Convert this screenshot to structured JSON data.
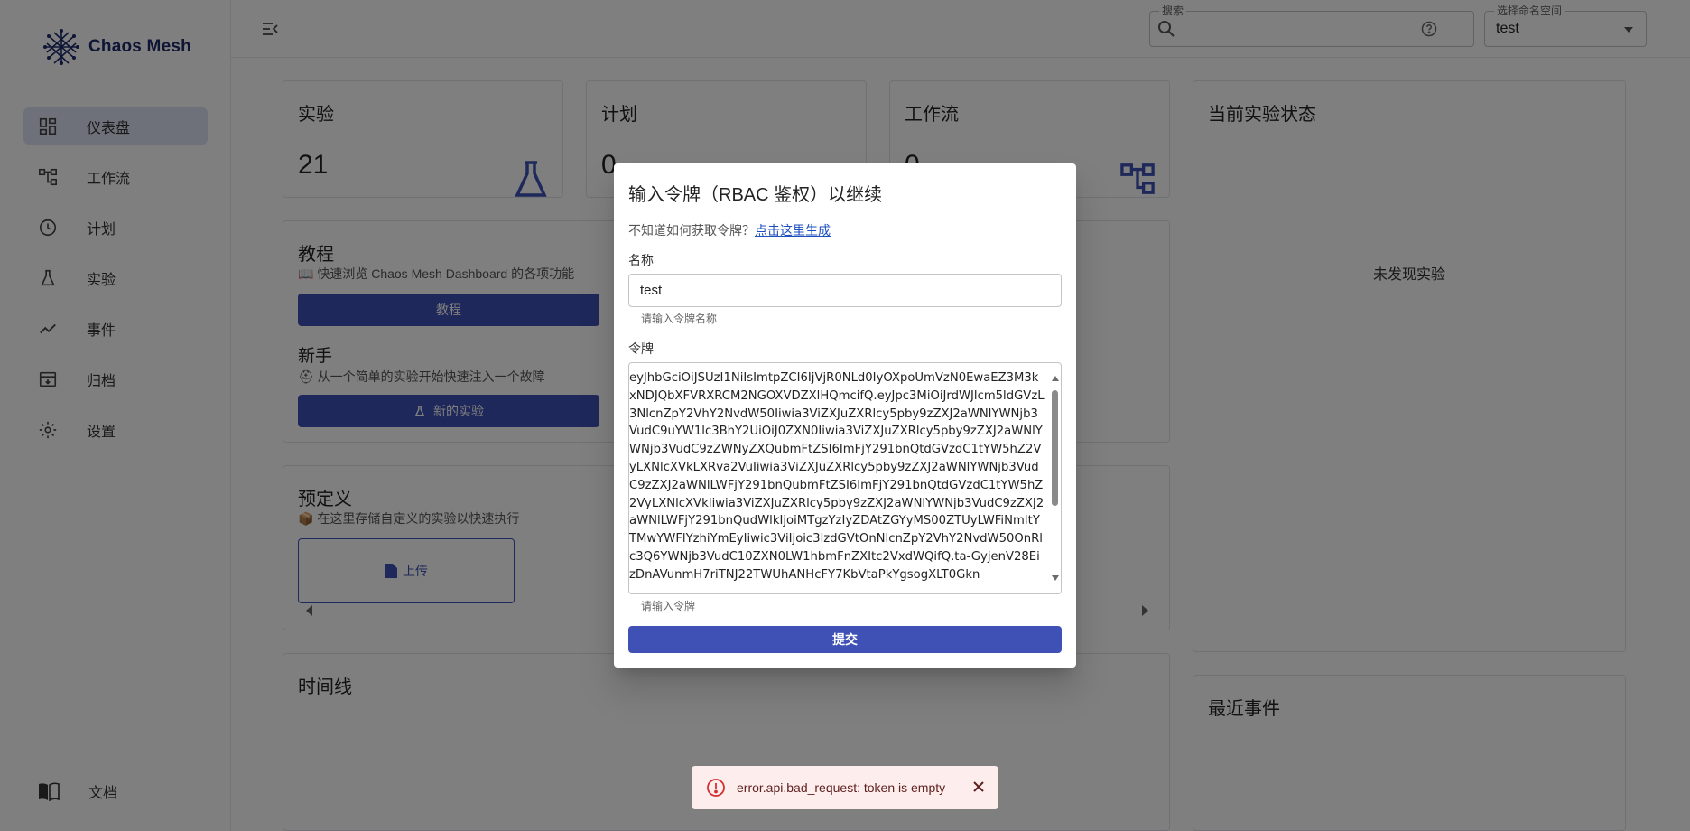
{
  "app": {
    "name": "Chaos Mesh"
  },
  "sidebar": {
    "items": [
      {
        "label": "仪表盘",
        "icon": "dashboard-icon",
        "active": true
      },
      {
        "label": "工作流",
        "icon": "workflow-icon"
      },
      {
        "label": "计划",
        "icon": "clock-icon"
      },
      {
        "label": "实验",
        "icon": "flask-icon"
      },
      {
        "label": "事件",
        "icon": "trending-icon"
      },
      {
        "label": "归档",
        "icon": "archive-icon"
      },
      {
        "label": "设置",
        "icon": "gear-icon"
      }
    ],
    "docs_label": "文档"
  },
  "topbar": {
    "search_label": "搜索",
    "search_value": "",
    "namespace_label": "选择命名空间",
    "namespace_value": "test"
  },
  "dashboard": {
    "stats": [
      {
        "title": "实验",
        "value": "21"
      },
      {
        "title": "计划",
        "value": "0"
      },
      {
        "title": "工作流",
        "value": "0"
      }
    ],
    "tutorial": {
      "title": "教程",
      "desc": "📖 快速浏览 Chaos Mesh Dashboard 的各项功能",
      "button": "教程",
      "newbie_title": "新手",
      "newbie_desc": "⛑ 从一个简单的实验开始快速注入一个故障",
      "new_experiment_button": "新的实验"
    },
    "predefined": {
      "title": "预定义",
      "desc": "📦 在这里存储自定义的实验以快速执行",
      "upload_label": "上传"
    },
    "timeline_title": "时间线",
    "current_status": {
      "title": "当前实验状态",
      "empty": "未发现实验"
    },
    "recent_events_title": "最近事件"
  },
  "dialog": {
    "title": "输入令牌（RBAC 鉴权）以继续",
    "hint_prefix": "不知道如何获取令牌？",
    "hint_link": "点击这里生成",
    "name_label": "名称",
    "name_value": "test",
    "name_helper": "请输入令牌名称",
    "token_label": "令牌",
    "token_value": "eyJhbGciOiJSUzI1NiIsImtpZCI6IjVjR0NLd0IyOXpoUmVzN0EwaEZ3M3kxNDJQbXFVRXRCM2NGOXVDZXlHQmcifQ.eyJpc3MiOiJrdWJlcm5ldGVzL3NlcnZpY2VhY2NvdW50Iiwia3ViZXJuZXRlcy5pby9zZXJ2aWNlYWNjb3VudC9uYW1lc3BhY2UiOiJ0ZXN0Iiwia3ViZXJuZXRlcy5pby9zZXJ2aWNlYWNjb3VudC9zZWNyZXQubmFtZSI6ImFjY291bnQtdGVzdC1tYW5hZ2VyLXNlcXVkLXRva2VuIiwia3ViZXJuZXRlcy5pby9zZXJ2aWNlYWNjb3VudC9zZXJ2aWNlLWFjY291bnQubmFtZSI6ImFjY291bnQtdGVzdC1tYW5hZ2VyLXNlcXVkIiwia3ViZXJuZXRlcy5pby9zZXJ2aWNlYWNjb3VudC9zZXJ2aWNlLWFjY291bnQudWlkIjoiMTgzYzIyZDAtZGYyMS00ZTUyLWFiNmItYTMwYWFlYzhiYmEyIiwic3ViIjoic3lzdGVtOnNlcnZpY2VhY2NvdW50OnRlc3Q6YWNjb3VudC10ZXN0LW1hbmFnZXItc2VxdWQifQ.ta-GyjenV28EizDnAVunmH7riTNJ22TWUhANHcFY7KbVtaPkYgsogXLT0Gkn",
    "token_helper": "请输入令牌",
    "submit_label": "提交"
  },
  "toast": {
    "message": "error.api.bad_request: token is empty"
  },
  "colors": {
    "primary": "#3f51b5",
    "active_nav": "#dde2f5",
    "error_bg": "#fdeded"
  }
}
